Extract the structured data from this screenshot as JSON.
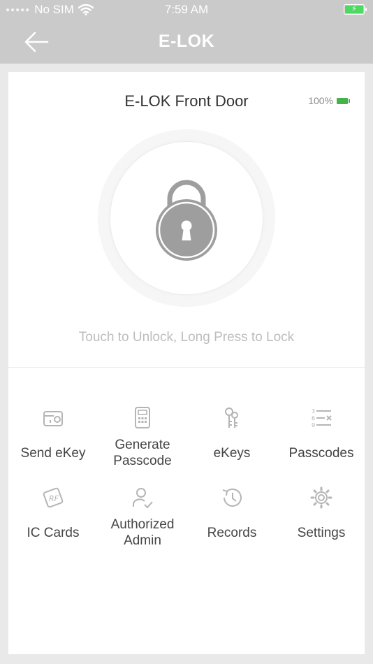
{
  "status": {
    "carrier": "No SIM",
    "time": "7:59 AM"
  },
  "nav": {
    "title": "E-LOK"
  },
  "lock": {
    "name": "E-LOK Front Door",
    "battery": "100%"
  },
  "hint": "Touch to Unlock, Long Press to Lock",
  "features": [
    {
      "label": "Send eKey",
      "icon": "send-ekey-icon"
    },
    {
      "label": "Generate\nPasscode",
      "icon": "keypad-icon"
    },
    {
      "label": "eKeys",
      "icon": "keys-icon"
    },
    {
      "label": "Passcodes",
      "icon": "passcodes-icon"
    },
    {
      "label": "IC Cards",
      "icon": "rf-card-icon"
    },
    {
      "label": "Authorized\nAdmin",
      "icon": "admin-user-icon"
    },
    {
      "label": "Records",
      "icon": "history-icon"
    },
    {
      "label": "Settings",
      "icon": "gear-icon"
    }
  ],
  "colors": {
    "header": "#cacaca",
    "battery_green": "#43b34a",
    "icon_gray": "#b5b5b5"
  }
}
